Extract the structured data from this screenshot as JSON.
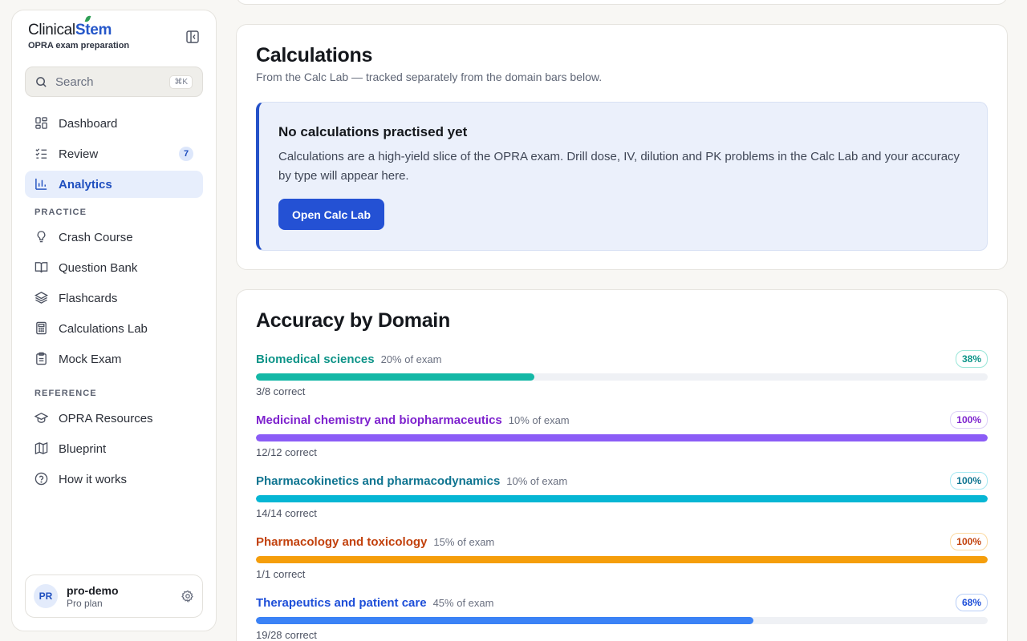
{
  "brand": {
    "name_part1": "Clinical",
    "name_part2": "Stem",
    "subtitle": "OPRA exam preparation"
  },
  "search": {
    "placeholder": "Search",
    "shortcut": "⌘K"
  },
  "nav": [
    {
      "label": "Dashboard",
      "icon": "dashboard-icon"
    },
    {
      "label": "Review",
      "icon": "review-checklist-icon",
      "badge": "7"
    },
    {
      "label": "Analytics",
      "icon": "bar-chart-icon",
      "active": true
    }
  ],
  "practice": {
    "heading": "PRACTICE",
    "items": [
      {
        "label": "Crash Course",
        "icon": "lightbulb-icon"
      },
      {
        "label": "Question Bank",
        "icon": "book-open-icon"
      },
      {
        "label": "Flashcards",
        "icon": "layers-icon"
      },
      {
        "label": "Calculations Lab",
        "icon": "calculator-icon"
      },
      {
        "label": "Mock Exam",
        "icon": "clipboard-icon"
      }
    ]
  },
  "reference": {
    "heading": "REFERENCE",
    "items": [
      {
        "label": "OPRA Resources",
        "icon": "graduation-cap-icon"
      },
      {
        "label": "Blueprint",
        "icon": "map-icon"
      },
      {
        "label": "How it works",
        "icon": "help-circle-icon"
      }
    ]
  },
  "user": {
    "initials": "PR",
    "name": "pro-demo",
    "plan": "Pro plan"
  },
  "calculations": {
    "title": "Calculations",
    "subtitle": "From the Calc Lab — tracked separately from the domain bars below.",
    "empty_title": "No calculations practised yet",
    "empty_text": "Calculations are a high-yield slice of the OPRA exam. Drill dose, IV, dilution and PK problems in the Calc Lab and your accuracy by type will appear here.",
    "button_label": "Open Calc Lab"
  },
  "domains": {
    "title": "Accuracy by Domain",
    "items": [
      {
        "name": "Biomedical sciences",
        "weight": "20% of exam",
        "percent_label": "38%",
        "accuracy": 0.38,
        "correct": "3/8 correct",
        "color": "#0d9488",
        "bar": "#14b8a6",
        "pill_border": "#99e6d8"
      },
      {
        "name": "Medicinal chemistry and biopharmaceutics",
        "weight": "10% of exam",
        "percent_label": "100%",
        "accuracy": 1.0,
        "correct": "12/12 correct",
        "color": "#7e22ce",
        "bar": "#8b5cf6",
        "pill_border": "#ddd0f7"
      },
      {
        "name": "Pharmacokinetics and pharmacodynamics",
        "weight": "10% of exam",
        "percent_label": "100%",
        "accuracy": 1.0,
        "correct": "14/14 correct",
        "color": "#0e7490",
        "bar": "#06b6d4",
        "pill_border": "#a5e8f2"
      },
      {
        "name": "Pharmacology and toxicology",
        "weight": "15% of exam",
        "percent_label": "100%",
        "accuracy": 1.0,
        "correct": "1/1 correct",
        "color": "#c2410c",
        "bar": "#f59e0b",
        "pill_border": "#fbd9a0"
      },
      {
        "name": "Therapeutics and patient care",
        "weight": "45% of exam",
        "percent_label": "68%",
        "accuracy": 0.68,
        "correct": "19/28 correct",
        "color": "#1d4ed8",
        "bar": "#3b82f6",
        "pill_border": "#b9cff8"
      }
    ]
  }
}
